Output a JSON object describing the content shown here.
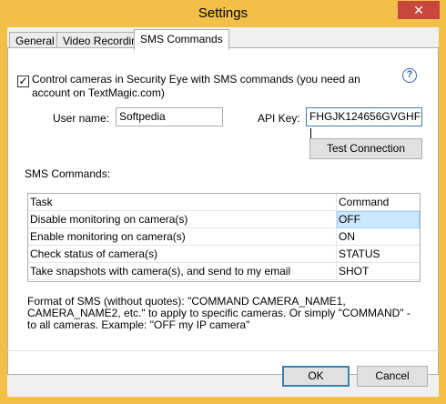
{
  "window": {
    "title": "Settings",
    "close_glyph": "✕"
  },
  "tabs": [
    {
      "label": "General",
      "active": false
    },
    {
      "label": "Video Recording",
      "active": false
    },
    {
      "label": "SMS Commands",
      "active": true
    }
  ],
  "sms": {
    "enable_checked": true,
    "check_glyph": "✓",
    "enable_label": "Control cameras in Security Eye with SMS commands (you need an account on TextMagic.com)",
    "help_glyph": "?",
    "username_label": "User name:",
    "username_value": "Softpedia",
    "apikey_label": "API Key:",
    "apikey_value": "FHGJK124656GVGHF",
    "test_button": "Test Connection",
    "commands_label": "SMS Commands:",
    "table": {
      "headers": [
        "Task",
        "Command"
      ],
      "rows": [
        {
          "task": "Disable monitoring on camera(s)",
          "command": "OFF",
          "selected": true
        },
        {
          "task": "Enable monitoring on camera(s)",
          "command": "ON",
          "selected": false
        },
        {
          "task": "Check status of camera(s)",
          "command": "STATUS",
          "selected": false
        },
        {
          "task": "Take snapshots with camera(s), and send to my email",
          "command": "SHOT",
          "selected": false
        }
      ]
    },
    "format_note": "Format of SMS (without quotes): \"COMMAND CAMERA_NAME1, CAMERA_NAME2, etc.\" to apply to specific cameras. Or simply \"COMMAND\" - to all cameras. Example: \"OFF my IP camera\""
  },
  "buttons": {
    "ok": "OK",
    "cancel": "Cancel"
  },
  "colors": {
    "frame": "#f2bf47",
    "close": "#c7463e",
    "selection": "#cce8ff",
    "focus": "#3c7fb1"
  }
}
